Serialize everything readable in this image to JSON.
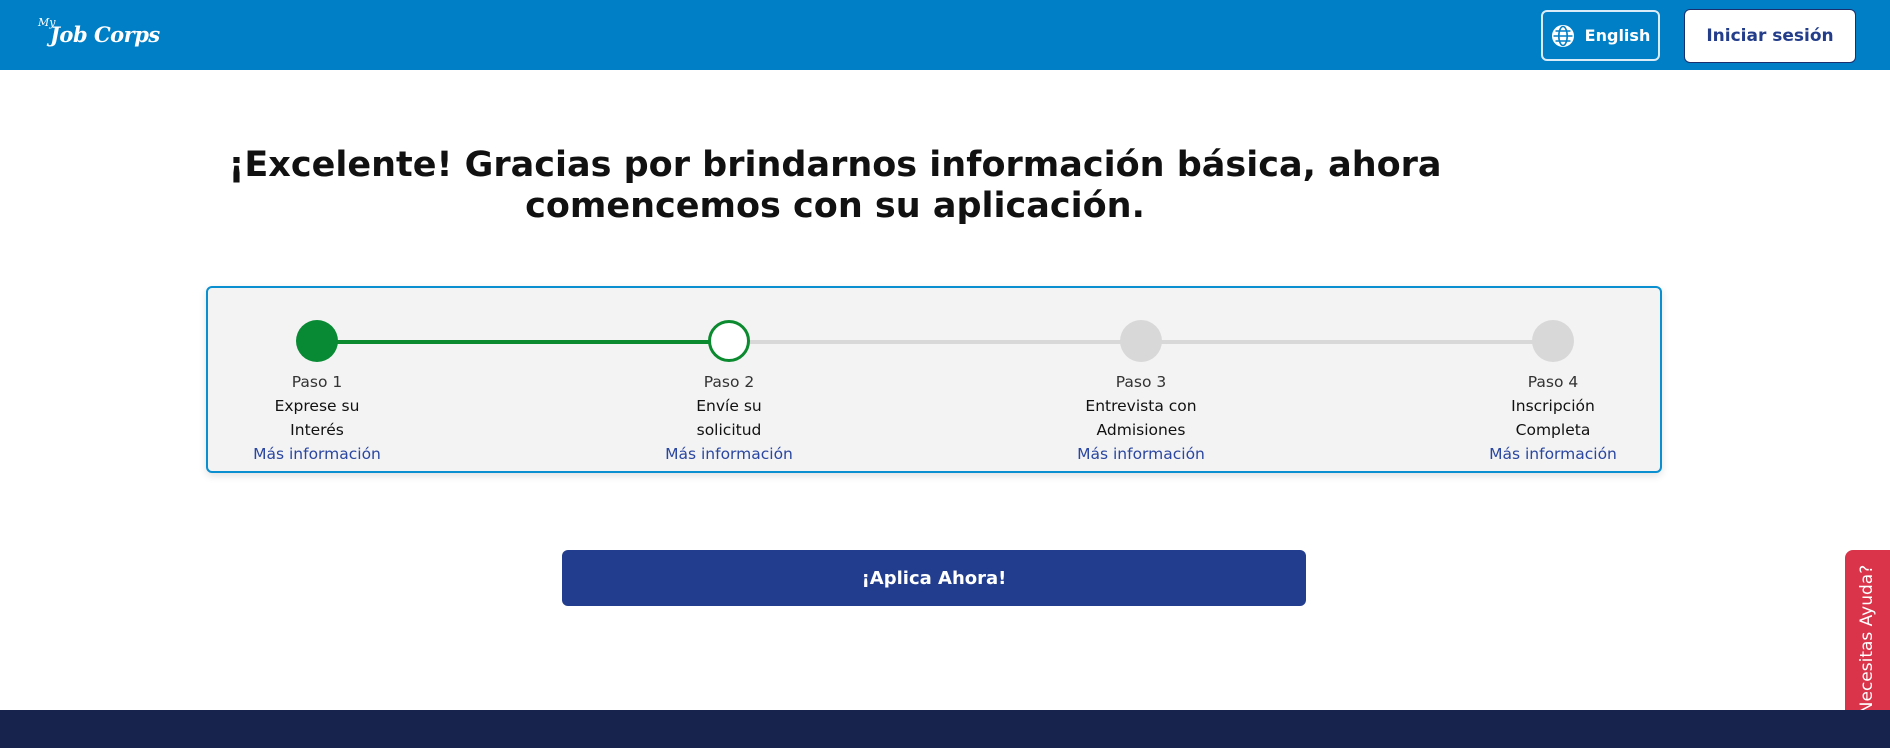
{
  "header": {
    "logo_prefix": "My",
    "logo_brand": "Job Corps",
    "language_button": "English",
    "login_button": "Iniciar sesión"
  },
  "main": {
    "title": "¡Excelente! Gracias por brindarnos información básica, ahora comencemos con su aplicación.",
    "apply_button": "¡Aplica Ahora!"
  },
  "stepper": {
    "steps": [
      {
        "number": "Paso 1",
        "name_line1": "Exprese su",
        "name_line2": "Interés",
        "link": "Más información",
        "status": "complete"
      },
      {
        "number": "Paso 2",
        "name_line1": "Envíe su",
        "name_line2": "solicitud",
        "link": "Más información",
        "status": "current"
      },
      {
        "number": "Paso 3",
        "name_line1": "Entrevista con",
        "name_line2": "Admisiones",
        "link": "Más información",
        "status": "pending"
      },
      {
        "number": "Paso 4",
        "name_line1": "Inscripción",
        "name_line2": "Completa",
        "link": "Más información",
        "status": "pending"
      }
    ]
  },
  "help_tab": {
    "label": "¿Necesitas Ayuda?"
  },
  "colors": {
    "header_bg": "#007fc6",
    "complete_green": "#078a33",
    "apply_button_bg": "#233d8e",
    "help_tab_bg": "#d9344a",
    "footer_bg": "#18234d"
  },
  "icons": {
    "language": "globe-icon"
  }
}
